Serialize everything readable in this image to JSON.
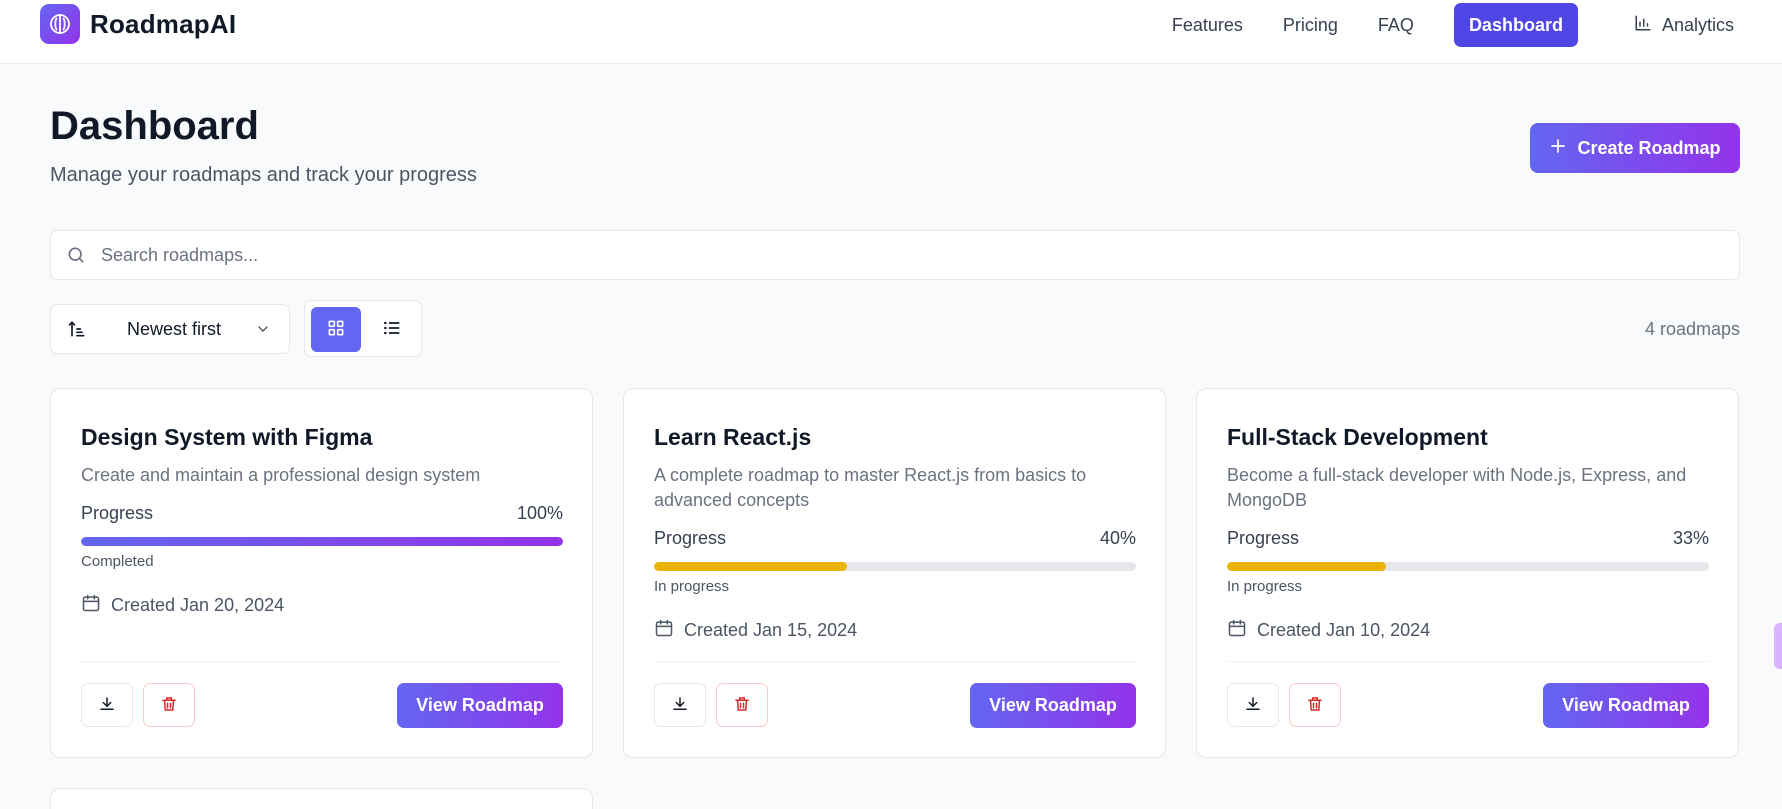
{
  "header": {
    "brand": "RoadmapAI",
    "nav": {
      "features": "Features",
      "pricing": "Pricing",
      "faq": "FAQ",
      "dashboard": "Dashboard",
      "analytics": "Analytics"
    }
  },
  "page": {
    "title": "Dashboard",
    "subtitle": "Manage your roadmaps and track your progress",
    "create_label": "Create Roadmap"
  },
  "search": {
    "placeholder": "Search roadmaps..."
  },
  "toolbar": {
    "sort_selected": "Newest first",
    "view_mode": "grid",
    "count_label": "4 roadmaps"
  },
  "colors": {
    "accent": "#4f46e5",
    "gradient_start": "#6366f1",
    "gradient_end": "#9333ea",
    "progress_in": "#eab308",
    "danger": "#dc2626"
  },
  "cards": [
    {
      "title": "Design System with Figma",
      "description": "Create and maintain a professional design system",
      "progress_label": "Progress",
      "progress": 100,
      "progress_text": "100%",
      "status": "Completed",
      "created": "Created Jan 20, 2024",
      "view_label": "View Roadmap"
    },
    {
      "title": "Learn React.js",
      "description": "A complete roadmap to master React.js from basics to advanced concepts",
      "progress_label": "Progress",
      "progress": 40,
      "progress_text": "40%",
      "status": "In progress",
      "created": "Created Jan 15, 2024",
      "view_label": "View Roadmap"
    },
    {
      "title": "Full-Stack Development",
      "description": "Become a full-stack developer with Node.js, Express, and MongoDB",
      "progress_label": "Progress",
      "progress": 33,
      "progress_text": "33%",
      "status": "In progress",
      "created": "Created Jan 10, 2024",
      "view_label": "View Roadmap"
    }
  ]
}
